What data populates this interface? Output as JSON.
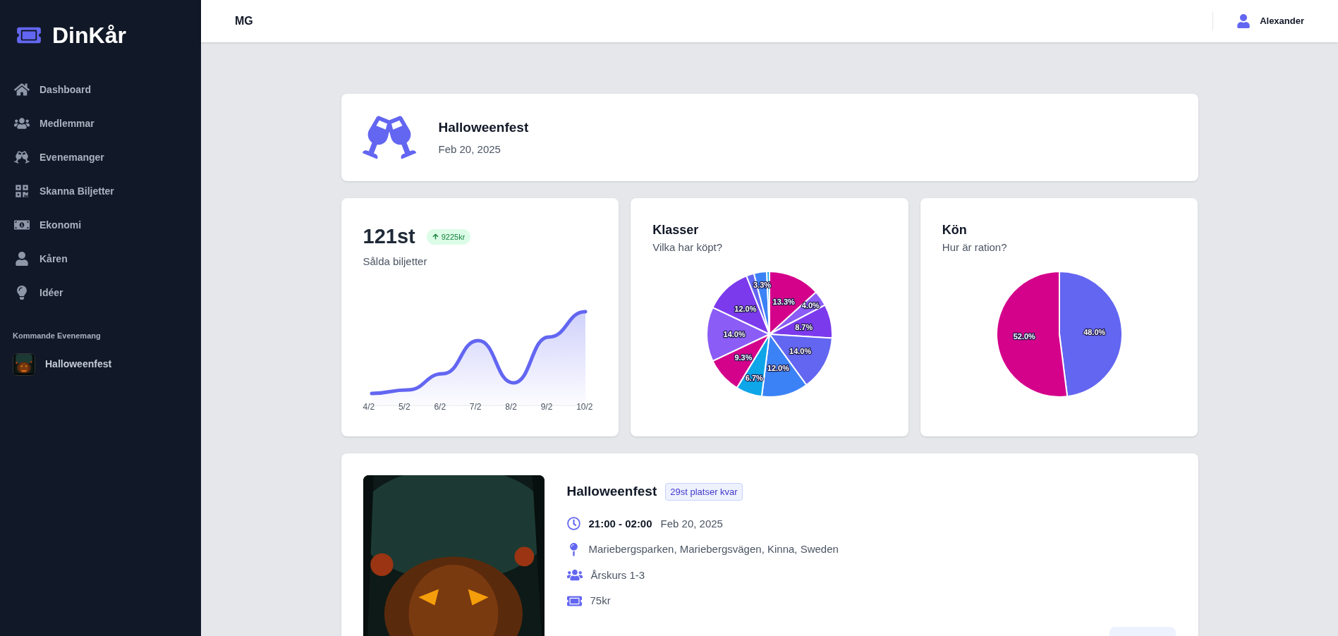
{
  "sidebar": {
    "logo": "DinKår",
    "items": [
      {
        "label": "Dashboard",
        "kind": "home"
      },
      {
        "label": "Medlemmar",
        "kind": "users"
      },
      {
        "label": "Evenemanger",
        "kind": "cheers"
      },
      {
        "label": "Skanna Biljetter",
        "kind": "qr"
      },
      {
        "label": "Ekonomi",
        "kind": "money"
      },
      {
        "label": "Kåren",
        "kind": "user"
      },
      {
        "label": "Idéer",
        "kind": "idea"
      }
    ],
    "section_title": "Kommande Evenemang",
    "events": [
      {
        "label": "Halloweenfest"
      }
    ]
  },
  "header": {
    "org": "MG",
    "user": "Alexander"
  },
  "event_header": {
    "title": "Halloweenfest",
    "date": "Feb 20, 2025"
  },
  "sales": {
    "count": "121st",
    "badge": "9225kr",
    "subtitle": "Sålda biljetter",
    "x_labels": [
      "4/2",
      "5/2",
      "6/2",
      "7/2",
      "8/2",
      "9/2",
      "10/2"
    ]
  },
  "classes": {
    "title": "Klasser",
    "subtitle": "Vilka har köpt?",
    "chart_data": {
      "type": "pie",
      "values": [
        13.3,
        4.0,
        8.7,
        14.0,
        12.0,
        6.7,
        9.3,
        14.0,
        12.0,
        2.0,
        3.3,
        0.7
      ],
      "colors": [
        "#d4028b",
        "#8b5cf6",
        "#7c3aed",
        "#6366f1",
        "#3b82f6",
        "#0ea5e9",
        "#d4028b",
        "#8b5cf6",
        "#7c3aed",
        "#6366f1",
        "#3b82f6",
        "#0ea5e9"
      ],
      "value_labels": [
        "13.3%",
        "4.0%",
        "8.7%",
        "14.0%",
        "12.0%",
        "6.7%",
        "9.3%",
        "14.0%",
        "12.0%",
        null,
        "3.3%",
        null
      ]
    }
  },
  "gender": {
    "title": "Kön",
    "subtitle": "Hur är ration?",
    "chart_data": {
      "type": "pie",
      "values": [
        48.0,
        52.0
      ],
      "colors": [
        "#6366f1",
        "#d4028b"
      ],
      "value_labels": [
        "48.0%",
        "52.0%"
      ]
    }
  },
  "event_card": {
    "title": "Halloweenfest",
    "badge": "29st platser kvar",
    "time": "21:00 - 02:00",
    "date": "Feb 20, 2025",
    "location": "Mariebergsparken, Mariebergsvägen, Kinna, Sweden",
    "audience": "Årskurs 1-3",
    "price": "75kr"
  }
}
